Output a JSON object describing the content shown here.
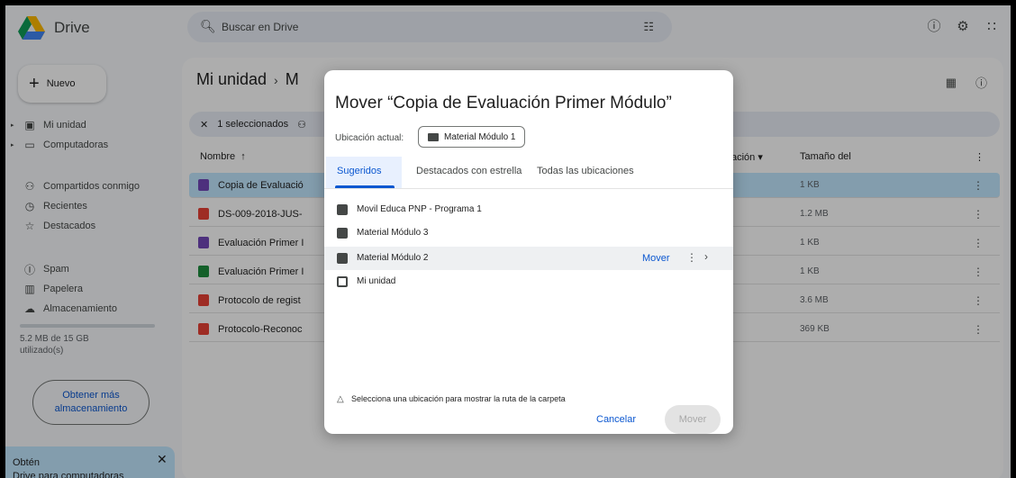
{
  "app": {
    "name": "Drive"
  },
  "search": {
    "placeholder": "Buscar en Drive"
  },
  "sidebar": {
    "new_label": "Nuevo",
    "items": [
      {
        "label": "Mi unidad",
        "icon": "drive-icon"
      },
      {
        "label": "Computadoras",
        "icon": "computer-icon"
      },
      {
        "label": "Compartidos conmigo",
        "icon": "people-icon"
      },
      {
        "label": "Recientes",
        "icon": "clock-icon"
      },
      {
        "label": "Destacados",
        "icon": "star-icon"
      },
      {
        "label": "Spam",
        "icon": "spam-icon"
      },
      {
        "label": "Papelera",
        "icon": "trash-icon"
      },
      {
        "label": "Almacenamiento",
        "icon": "cloud-icon"
      }
    ],
    "storage_text": "5.2 MB de 15 GB utilizado(s)",
    "storage_fraction": 0.0003,
    "more_storage_label": "Obtener más almacenamiento",
    "promo_line1": "Obtén",
    "promo_line2": "Drive para computadoras"
  },
  "main": {
    "breadcrumb_root": "Mi unidad",
    "breadcrumb_rest": "M",
    "selection_label": "1 seleccionados",
    "columns": {
      "name": "Nombre",
      "modified": "ación",
      "size": "Tamaño del"
    },
    "files": [
      {
        "name": "Copia de Evaluació",
        "size": "1 KB",
        "type": "forms",
        "selected": true
      },
      {
        "name": "DS-009-2018-JUS-",
        "size": "1.2 MB",
        "type": "pdf",
        "selected": false
      },
      {
        "name": "Evaluación Primer I",
        "size": "1 KB",
        "type": "forms",
        "selected": false
      },
      {
        "name": "Evaluación Primer I",
        "size": "1 KB",
        "type": "sheets",
        "selected": false
      },
      {
        "name": "Protocolo de regist",
        "size": "3.6 MB",
        "type": "pdf",
        "selected": false
      },
      {
        "name": "Protocolo-Reconoc",
        "size": "369 KB",
        "type": "pdf",
        "selected": false
      }
    ]
  },
  "dialog": {
    "title": "Mover “Copia de Evaluación Primer Módulo”",
    "current_location_label": "Ubicación actual:",
    "current_location": "Material Módulo 1",
    "tabs": [
      "Sugeridos",
      "Destacados con estrella",
      "Todas las ubicaciones"
    ],
    "locations": [
      {
        "name": "Movil Educa PNP - Programa 1",
        "icon": "shared-folder-icon"
      },
      {
        "name": "Material Módulo 3",
        "icon": "shared-folder-icon"
      },
      {
        "name": "Material Módulo 2",
        "icon": "shared-folder-icon",
        "hover": true
      },
      {
        "name": "Mi unidad",
        "icon": "drive-icon"
      }
    ],
    "row_move_label": "Mover",
    "hint": "Selecciona una ubicación para mostrar la ruta de la carpeta",
    "cancel_label": "Cancelar",
    "move_label": "Mover"
  },
  "colors": {
    "accent": "#0b57d0",
    "selected_row": "#c2e7ff",
    "pdf": "#e94235",
    "forms": "#7248b9",
    "sheets": "#1e8e3e"
  }
}
